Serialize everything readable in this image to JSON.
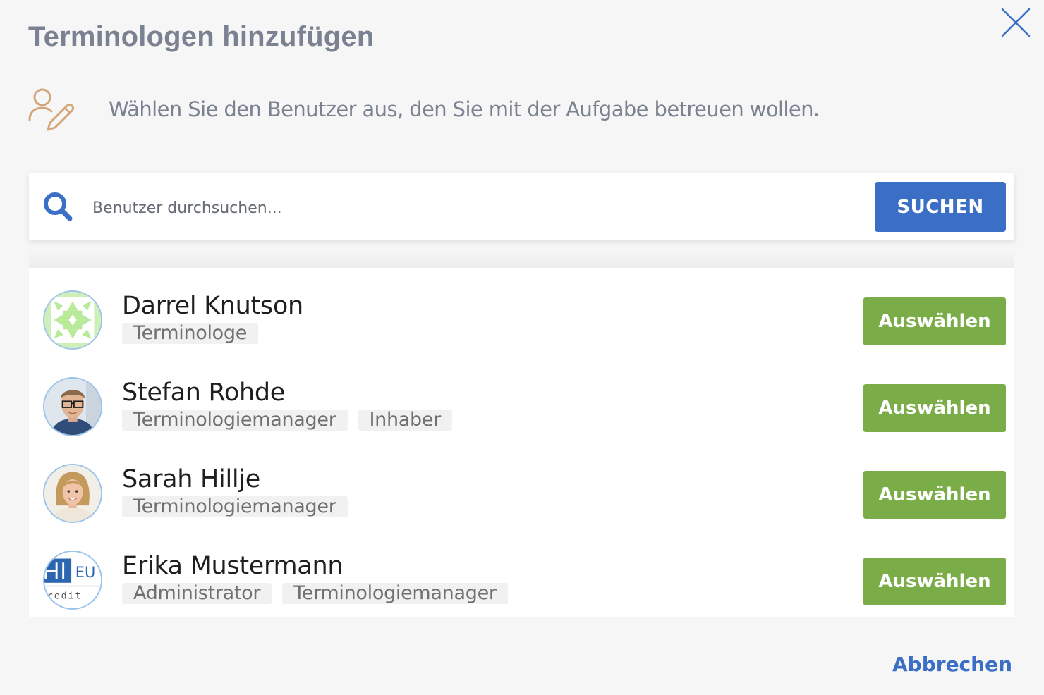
{
  "dialog": {
    "title": "Terminologen hinzufügen",
    "intro_text": "Wählen Sie den Benutzer aus, den Sie mit der Aufgabe betreuen wollen.",
    "close_icon": "close-icon",
    "intro_icon": "user-edit-icon"
  },
  "search": {
    "placeholder": "Benutzer durchsuchen...",
    "value": "",
    "button_label": "SUCHEN",
    "icon": "search-icon"
  },
  "users": [
    {
      "name": "Darrel Knutson",
      "roles": [
        "Terminologe"
      ],
      "select_label": "Auswählen",
      "avatar": "identicon-avatar"
    },
    {
      "name": "Stefan Rohde",
      "roles": [
        "Terminologiemanager",
        "Inhaber"
      ],
      "select_label": "Auswählen",
      "avatar": "photo-avatar"
    },
    {
      "name": "Sarah Hillje",
      "roles": [
        "Terminologiemanager"
      ],
      "select_label": "Auswählen",
      "avatar": "photo-avatar"
    },
    {
      "name": "Erika Mustermann",
      "roles": [
        "Administrator",
        "Terminologiemanager"
      ],
      "select_label": "Auswählen",
      "avatar": "logo-avatar",
      "avatar_logo_text": "EU",
      "avatar_logo_subtext": "redit"
    }
  ],
  "footer": {
    "cancel_label": "Abbrechen"
  },
  "colors": {
    "title": "#7a8191",
    "primary": "#3b6fc5",
    "select_button": "#7aad47",
    "intro_icon": "#d2a679",
    "background": "#f6f6f6"
  }
}
